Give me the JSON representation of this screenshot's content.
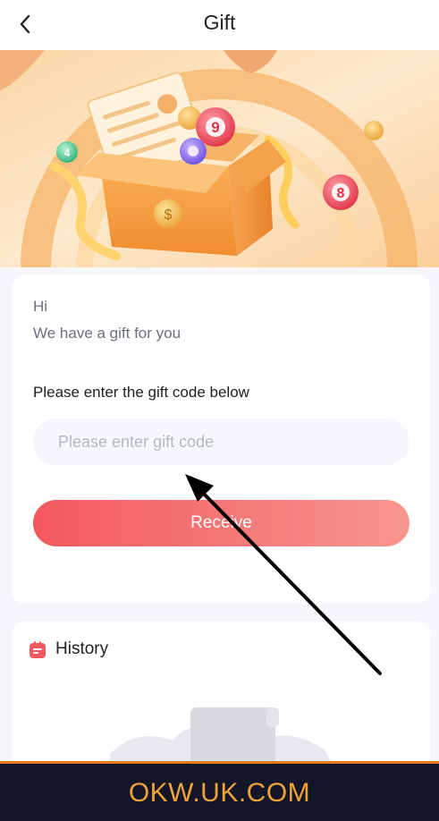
{
  "header": {
    "title": "Gift",
    "back_icon": "chevron-left-icon"
  },
  "banner": {
    "ball_numbers": [
      "4",
      "9",
      "8"
    ]
  },
  "gift_card": {
    "greeting": "Hi",
    "message": "We have a gift for you",
    "code_label": "Please enter the gift code below",
    "code_input": {
      "value": "",
      "placeholder": "Please enter gift code"
    },
    "receive_label": "Receive"
  },
  "history": {
    "title": "History",
    "icon": "history-list-icon"
  },
  "footer": {
    "text": "OKW.UK.COM"
  },
  "colors": {
    "accent_red": "#f4585f",
    "footer_bg": "#121628",
    "footer_text": "#f0a23a",
    "banner_orange": "#f7a24a"
  }
}
